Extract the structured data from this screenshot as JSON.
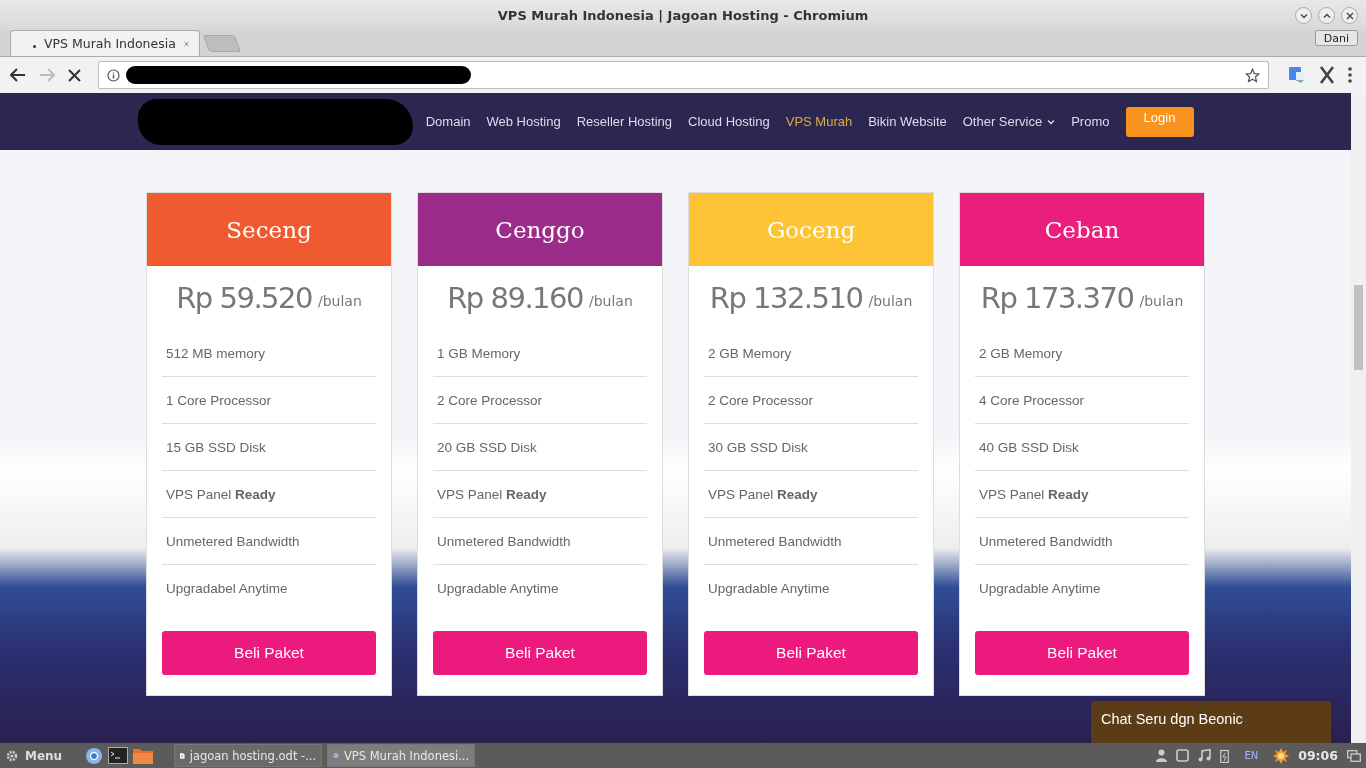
{
  "window": {
    "title": "VPS Murah Indonesia | Jagoan Hosting - Chromium",
    "profile": "Dani"
  },
  "tabs": [
    {
      "label": "VPS Murah Indonesia",
      "selected": true
    }
  ],
  "nav": {
    "items": [
      {
        "label": "Domain",
        "selected": false,
        "dropdown": false
      },
      {
        "label": "Web Hosting",
        "selected": false,
        "dropdown": false
      },
      {
        "label": "Reseller Hosting",
        "selected": false,
        "dropdown": false
      },
      {
        "label": "Cloud Hosting",
        "selected": false,
        "dropdown": false
      },
      {
        "label": "VPS Murah",
        "selected": true,
        "dropdown": false
      },
      {
        "label": "Bikin Website",
        "selected": false,
        "dropdown": false
      },
      {
        "label": "Other Service",
        "selected": false,
        "dropdown": true
      },
      {
        "label": "Promo",
        "selected": false,
        "dropdown": false
      }
    ],
    "login": "Login"
  },
  "plans": [
    {
      "name": "Seceng",
      "color": "#f05a30",
      "price": "Rp 59.520",
      "period": "/bulan",
      "features": [
        "512 MB memory",
        "1 Core Processor",
        "15 GB SSD Disk",
        "VPS Panel **Ready**",
        "Unmetered Bandwidth",
        "Upgradabel Anytime"
      ],
      "button": "Beli Paket"
    },
    {
      "name": "Cenggo",
      "color": "#9b2c8a",
      "price": "Rp 89.160",
      "period": "/bulan",
      "features": [
        "1 GB Memory",
        "2 Core Processor",
        "20 GB SSD Disk",
        "VPS Panel **Ready**",
        "Unmetered Bandwidth",
        "Upgradable Anytime"
      ],
      "button": "Beli Paket"
    },
    {
      "name": "Goceng",
      "color": "#fec436",
      "price": "Rp 132.510",
      "period": "/bulan",
      "features": [
        "2 GB Memory",
        "2 Core Processor",
        "30 GB SSD Disk",
        "VPS Panel **Ready**",
        "Unmetered Bandwidth",
        "Upgradable Anytime"
      ],
      "button": "Beli Paket"
    },
    {
      "name": "Ceban",
      "color": "#ea1e7b",
      "price": "Rp 173.370",
      "period": "/bulan",
      "features": [
        "2 GB Memory",
        "4 Core Processor",
        "40 GB SSD Disk",
        "VPS Panel **Ready**",
        "Unmetered Bandwidth",
        "Upgradable Anytime"
      ],
      "button": "Beli Paket"
    }
  ],
  "chat": "Chat Seru dgn Beonic",
  "taskbar": {
    "menu": "Menu",
    "tasks": [
      {
        "label": "jagoan hosting.odt -...",
        "kind": "document",
        "selected": false
      },
      {
        "label": "VPS Murah Indonesi...",
        "kind": "browser",
        "selected": true
      }
    ],
    "language": "EN",
    "clock": "09:06"
  }
}
